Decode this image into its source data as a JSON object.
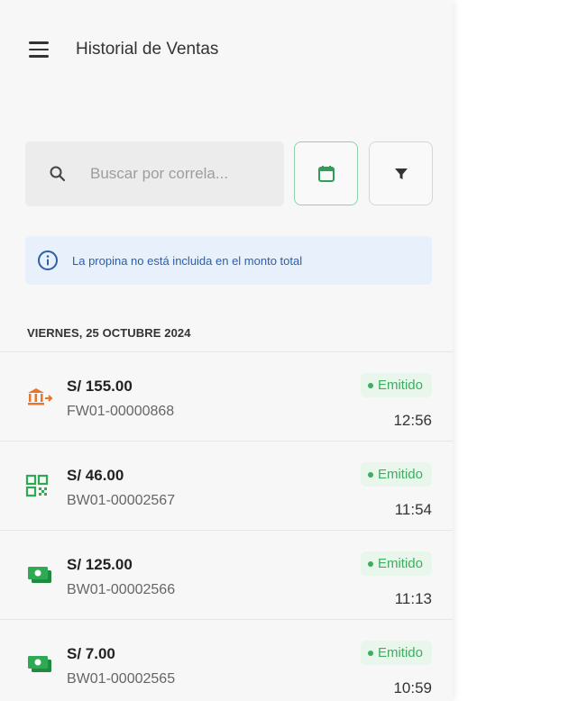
{
  "app": {
    "title": "Historial de Ventas"
  },
  "search": {
    "placeholder": "Buscar por correla..."
  },
  "info_banner": {
    "text": "La propina no está incluida en el monto total"
  },
  "date_header": "VIERNES, 25 OCTUBRE 2024",
  "sales": [
    {
      "amount": "S/ 155.00",
      "code": "FW01-00000868",
      "status": "Emitido",
      "time": "12:56",
      "method_icon": "bank-transfer-icon"
    },
    {
      "amount": "S/ 46.00",
      "code": "BW01-00002567",
      "status": "Emitido",
      "time": "11:54",
      "method_icon": "qr-code-icon"
    },
    {
      "amount": "S/ 125.00",
      "code": "BW01-00002566",
      "status": "Emitido",
      "time": "11:13",
      "method_icon": "cash-icon"
    },
    {
      "amount": "S/ 7.00",
      "code": "BW01-00002565",
      "status": "Emitido",
      "time": "10:59",
      "method_icon": "cash-icon"
    }
  ],
  "colors": {
    "accent_green": "#3cae60",
    "badge_bg": "#e8f6ec",
    "info_blue": "#2b5fa8",
    "info_bg": "#e8f0fb",
    "bank_orange": "#e8752a",
    "cash_green": "#2eaa55"
  }
}
